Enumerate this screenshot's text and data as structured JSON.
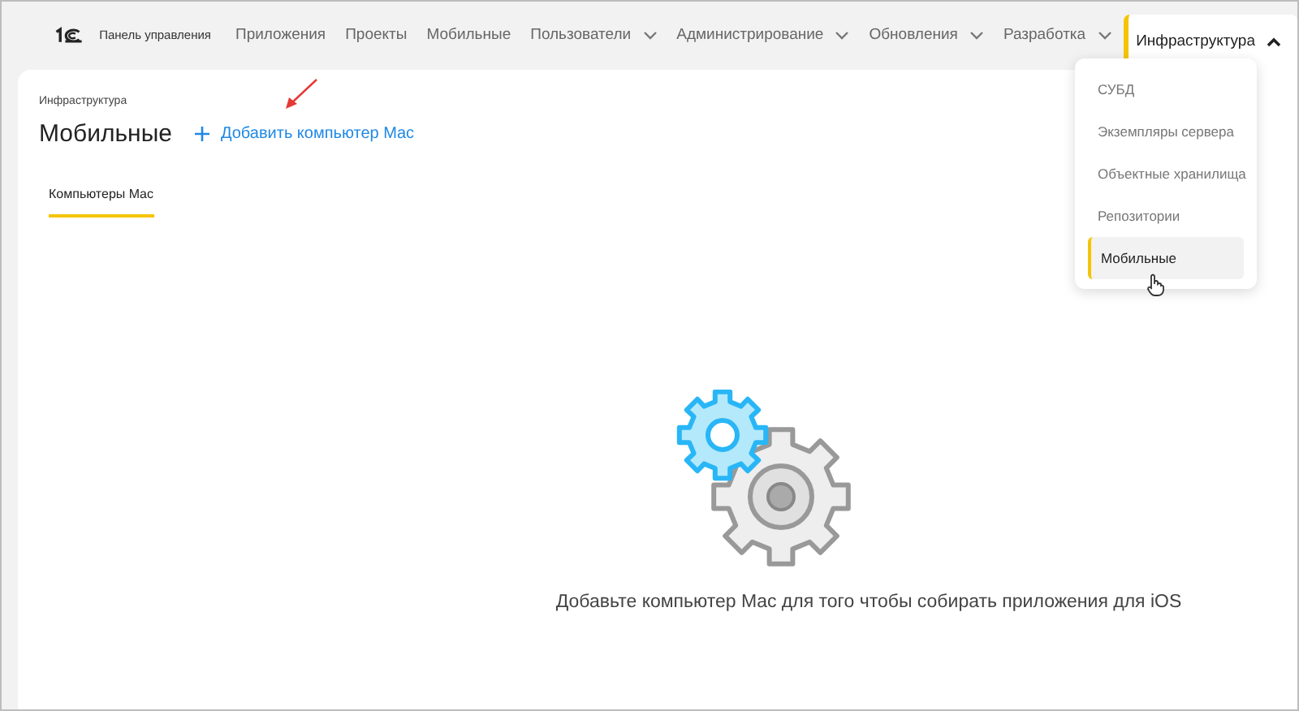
{
  "header": {
    "product": "Панель управления"
  },
  "nav": [
    {
      "label": "Приложения",
      "dropdown": false,
      "selected": false
    },
    {
      "label": "Проекты",
      "dropdown": false,
      "selected": false
    },
    {
      "label": "Мобильные",
      "dropdown": false,
      "selected": false
    },
    {
      "label": "Пользователи",
      "dropdown": true,
      "selected": false
    },
    {
      "label": "Администрирование",
      "dropdown": true,
      "selected": false
    },
    {
      "label": "Обновления",
      "dropdown": true,
      "selected": false
    },
    {
      "label": "Разработка",
      "dropdown": true,
      "selected": false
    },
    {
      "label": "Инфраструктура",
      "dropdown": true,
      "selected": true
    }
  ],
  "menu": [
    {
      "label": "СУБД",
      "selected": false
    },
    {
      "label": "Экземпляры сервера",
      "selected": false
    },
    {
      "label": "Объектные хранилища",
      "selected": false
    },
    {
      "label": "Репозитории",
      "selected": false
    },
    {
      "label": "Мобильные",
      "selected": true
    }
  ],
  "page": {
    "breadcrumb": "Инфраструктура",
    "title": "Мобильные",
    "add_button": "Добавить компьютер Mac"
  },
  "tabs": [
    {
      "label": "Компьютеры Mac",
      "selected": true
    }
  ],
  "empty": {
    "message": "Добавьте компьютер Mac для того чтобы собирать приложения для iOS"
  }
}
